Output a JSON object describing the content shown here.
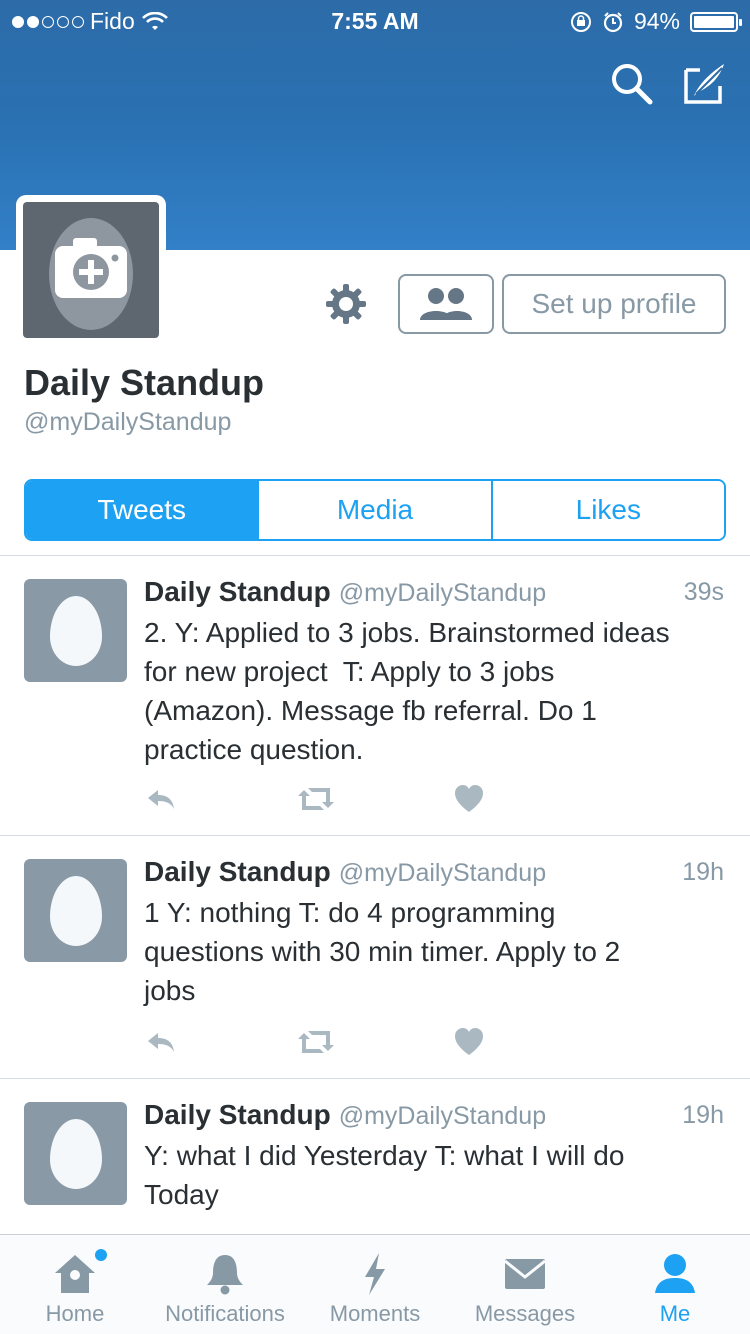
{
  "status_bar": {
    "carrier": "Fido",
    "time": "7:55 AM",
    "battery": "94%",
    "signal_bars_filled": 2,
    "signal_bars_total": 5
  },
  "header": {
    "search_icon": "search-icon",
    "compose_icon": "compose-icon"
  },
  "profile": {
    "name": "Daily Standup",
    "handle": "@myDailyStandup",
    "setup_button": "Set up profile"
  },
  "tabs": [
    {
      "label": "Tweets",
      "active": true
    },
    {
      "label": "Media",
      "active": false
    },
    {
      "label": "Likes",
      "active": false
    }
  ],
  "tweets": [
    {
      "name": "Daily Standup",
      "handle": "@myDailyStandup",
      "time": "39s",
      "text": "2. Y: Applied to 3 jobs. Brainstormed ideas\nfor new project  T: Apply to 3 jobs\n(Amazon). Message fb referral. Do 1\npractice question."
    },
    {
      "name": "Daily Standup",
      "handle": "@myDailyStandup",
      "time": "19h",
      "text": "1 Y: nothing T: do 4 programming\nquestions with 30 min timer. Apply to 2\njobs"
    },
    {
      "name": "Daily Standup",
      "handle": "@myDailyStandup",
      "time": "19h",
      "text": "Y: what I did Yesterday T: what I will do\nToday"
    }
  ],
  "tabbar": [
    {
      "label": "Home",
      "icon": "home-icon",
      "active": false
    },
    {
      "label": "Notifications",
      "icon": "bell-icon",
      "active": false
    },
    {
      "label": "Moments",
      "icon": "lightning-icon",
      "active": false
    },
    {
      "label": "Messages",
      "icon": "envelope-icon",
      "active": false
    },
    {
      "label": "Me",
      "icon": "person-icon",
      "active": true
    }
  ],
  "colors": {
    "accent": "#1da1f2",
    "header": "#2a72b4",
    "muted": "#8899a6",
    "text": "#292f33"
  }
}
